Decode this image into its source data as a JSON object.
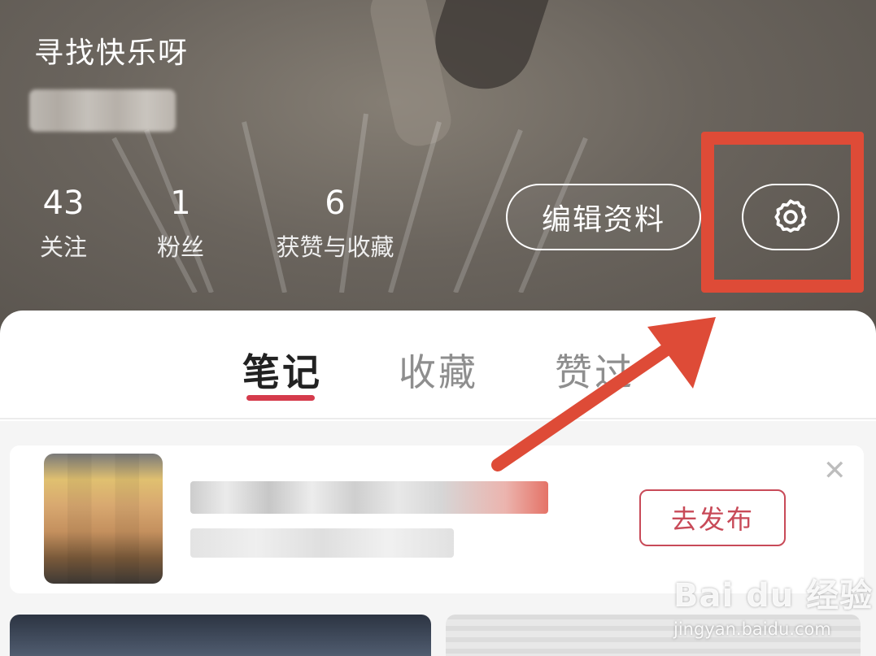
{
  "profile": {
    "username": "寻找快乐呀",
    "stats": [
      {
        "value": "43",
        "label": "关注"
      },
      {
        "value": "1",
        "label": "粉丝"
      },
      {
        "value": "6",
        "label": "获赞与收藏"
      }
    ],
    "edit_button_label": "编辑资料",
    "settings_icon": "gear-icon"
  },
  "tabs": {
    "items": [
      {
        "label": "笔记",
        "active": true
      },
      {
        "label": "收藏",
        "active": false
      },
      {
        "label": "赞过",
        "active": false
      }
    ]
  },
  "draft_prompt": {
    "publish_button_label": "去发布",
    "close_icon": "close-icon",
    "close_glyph": "✕"
  },
  "watermark": {
    "logo": "Bai du 经验",
    "url": "jingyan.baidu.com"
  },
  "colors": {
    "accent": "#d53b4c",
    "annotation": "#de4b37",
    "header_bg": "#6a645d"
  }
}
